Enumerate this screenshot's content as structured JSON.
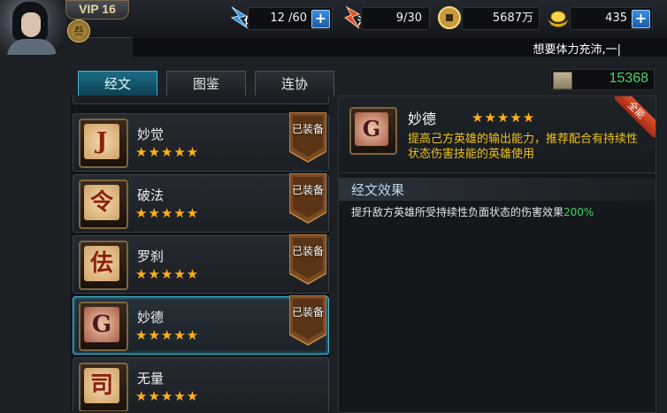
{
  "player": {
    "vip": "VIP 16",
    "rank_glyph": "叁"
  },
  "resources": {
    "stamina": {
      "label": "体",
      "value": "12 /60",
      "action": "+"
    },
    "vigor": {
      "label": "活",
      "value": "9/30"
    },
    "copper": {
      "value": "5687万"
    },
    "gold": {
      "value": "435",
      "action": "+"
    }
  },
  "ticker": {
    "text": "想要体力充沛,一|"
  },
  "tabs": [
    {
      "label": "经文"
    },
    {
      "label": "图鉴"
    },
    {
      "label": "连协"
    }
  ],
  "score": {
    "value": "15368"
  },
  "list": {
    "items": [
      {
        "name": "妙觉",
        "stars": "★★★★★",
        "equipped": "已装备",
        "glyph": "J"
      },
      {
        "name": "破法",
        "stars": "★★★★★",
        "equipped": "已装备",
        "glyph": "令"
      },
      {
        "name": "罗刹",
        "stars": "★★★★★",
        "equipped": "已装备",
        "glyph": "佉"
      },
      {
        "name": "妙德",
        "stars": "★★★★★",
        "equipped": "已装备",
        "glyph": "G"
      },
      {
        "name": "无量",
        "stars": "★★★★★",
        "equipped": "",
        "glyph": "司"
      }
    ]
  },
  "detail": {
    "name": "妙德",
    "stars": "★★★★★",
    "ribbon": "全能",
    "glyph": "G",
    "description": "提高己方英雄的输出能力，推荐配合有持续性状态伤害技能的英雄使用",
    "effect_header": "经文效果",
    "effect_text": "提升敌方英雄所受持续性负面状态的伤害效果",
    "effect_value": "200%"
  },
  "colors": {
    "accent_teal": "#3fb6d3",
    "star_gold": "#ffb11a",
    "desc_yellow": "#f0c11a",
    "positive_green": "#3fd35b"
  }
}
